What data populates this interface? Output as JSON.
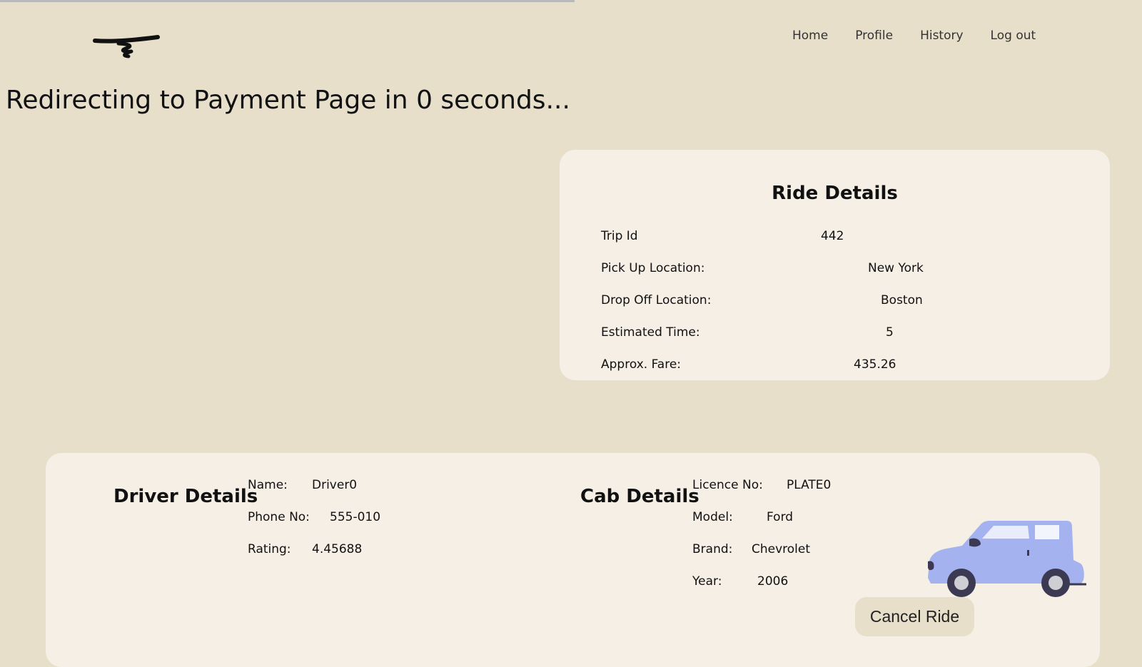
{
  "nav": {
    "home": "Home",
    "profile": "Profile",
    "history": "History",
    "logout": "Log out"
  },
  "redirect_message": "Redirecting to Payment Page in 0 seconds...",
  "ride": {
    "title": "Ride Details",
    "rows": [
      {
        "label": "Trip Id",
        "value": "442"
      },
      {
        "label": "Pick Up Location:",
        "value": "New York"
      },
      {
        "label": "Drop Off Location:",
        "value": "Boston"
      },
      {
        "label": "Estimated Time:",
        "value": "5"
      },
      {
        "label": "Approx. Fare:",
        "value": "435.26"
      }
    ]
  },
  "driver": {
    "title": "Driver Details",
    "rows": [
      {
        "label": "Name:",
        "value": "Driver0"
      },
      {
        "label": "Phone No:",
        "value": "555-010"
      },
      {
        "label": "Rating:",
        "value": "4.45688"
      }
    ]
  },
  "cab": {
    "title": "Cab Details",
    "rows": [
      {
        "label": "Licence No:",
        "value": "PLATE0"
      },
      {
        "label": "Model:",
        "value": "Ford"
      },
      {
        "label": "Brand:",
        "value": "Chevrolet"
      },
      {
        "label": "Year:",
        "value": "2006"
      }
    ]
  },
  "cancel_label": "Cancel Ride",
  "colors": {
    "background": "#e7dfca",
    "card": "#f5efe6",
    "car_body": "#a5b2f0",
    "car_wheels": "#3c3a52"
  }
}
